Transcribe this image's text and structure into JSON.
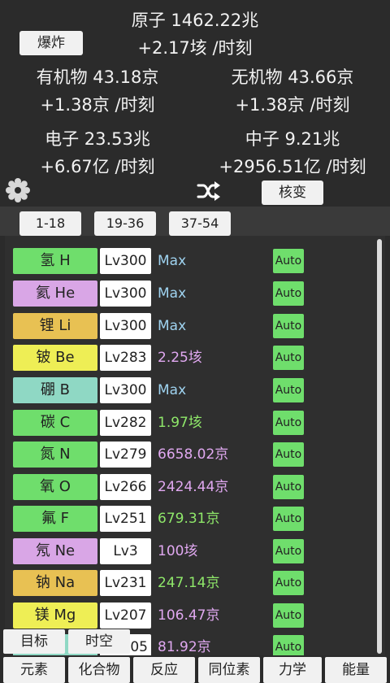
{
  "header": {
    "atom_line": "原子 1462.22兆",
    "atom_rate": "+2.17垓 /时刻",
    "explode_label": "爆炸",
    "organic_line": "有机物 43.18京",
    "organic_rate": "+1.38京 /时刻",
    "inorganic_line": "无机物 43.66京",
    "inorganic_rate": "+1.38京 /时刻",
    "electron_line": "电子 23.53兆",
    "electron_rate": "+6.67亿 /时刻",
    "neutron_line": "中子 9.21兆",
    "neutron_rate": "+2956.51亿 /时刻",
    "fission_label": "核变",
    "gear_icon": "gear-icon",
    "shuffle_icon": "shuffle-icon"
  },
  "tabs": [
    "1-18",
    "19-36",
    "37-54"
  ],
  "elements": [
    {
      "name": "氢 H",
      "level": "Lv300",
      "value": "Max",
      "auto": "Auto",
      "color": "#6fde6c",
      "value_color": "#9fd3f0"
    },
    {
      "name": "氦 He",
      "level": "Lv300",
      "value": "Max",
      "auto": "Auto",
      "color": "#d9a6e6",
      "value_color": "#9fd3f0"
    },
    {
      "name": "锂 Li",
      "level": "Lv300",
      "value": "Max",
      "auto": "Auto",
      "color": "#e8c153",
      "value_color": "#9fd3f0"
    },
    {
      "name": "铍 Be",
      "level": "Lv283",
      "value": "2.25垓",
      "auto": "Auto",
      "color": "#eeee55",
      "value_color": "#e0a8f0"
    },
    {
      "name": "硼 B",
      "level": "Lv300",
      "value": "Max",
      "auto": "Auto",
      "color": "#8fd8c4",
      "value_color": "#9fd3f0"
    },
    {
      "name": "碳 C",
      "level": "Lv282",
      "value": "1.97垓",
      "auto": "Auto",
      "color": "#6fde6c",
      "value_color": "#8fe86a"
    },
    {
      "name": "氮 N",
      "level": "Lv279",
      "value": "6658.02京",
      "auto": "Auto",
      "color": "#6fde6c",
      "value_color": "#e0a8f0"
    },
    {
      "name": "氧 O",
      "level": "Lv266",
      "value": "2424.44京",
      "auto": "Auto",
      "color": "#6fde6c",
      "value_color": "#e0a8f0"
    },
    {
      "name": "氟 F",
      "level": "Lv251",
      "value": "679.31京",
      "auto": "Auto",
      "color": "#6fde6c",
      "value_color": "#8fe86a"
    },
    {
      "name": "氖 Ne",
      "level": "Lv3",
      "value": "100垓",
      "auto": "Auto",
      "color": "#d9a6e6",
      "value_color": "#e0a8f0"
    },
    {
      "name": "钠 Na",
      "level": "Lv231",
      "value": "247.14京",
      "auto": "Auto",
      "color": "#e8c153",
      "value_color": "#8fe86a"
    },
    {
      "name": "镁 Mg",
      "level": "Lv207",
      "value": "106.47京",
      "auto": "Auto",
      "color": "#eeee55",
      "value_color": "#e0a8f0"
    },
    {
      "name": "",
      "level": "05",
      "value": "81.92京",
      "auto": "Auto",
      "color": "#8fd8c4",
      "value_color": "#e0a8f0"
    }
  ],
  "floating": {
    "goal_label": "目标",
    "spacetime_label": "时空"
  },
  "bottom_nav": [
    "元素",
    "化合物",
    "反应",
    "同位素",
    "力学",
    "能量"
  ]
}
